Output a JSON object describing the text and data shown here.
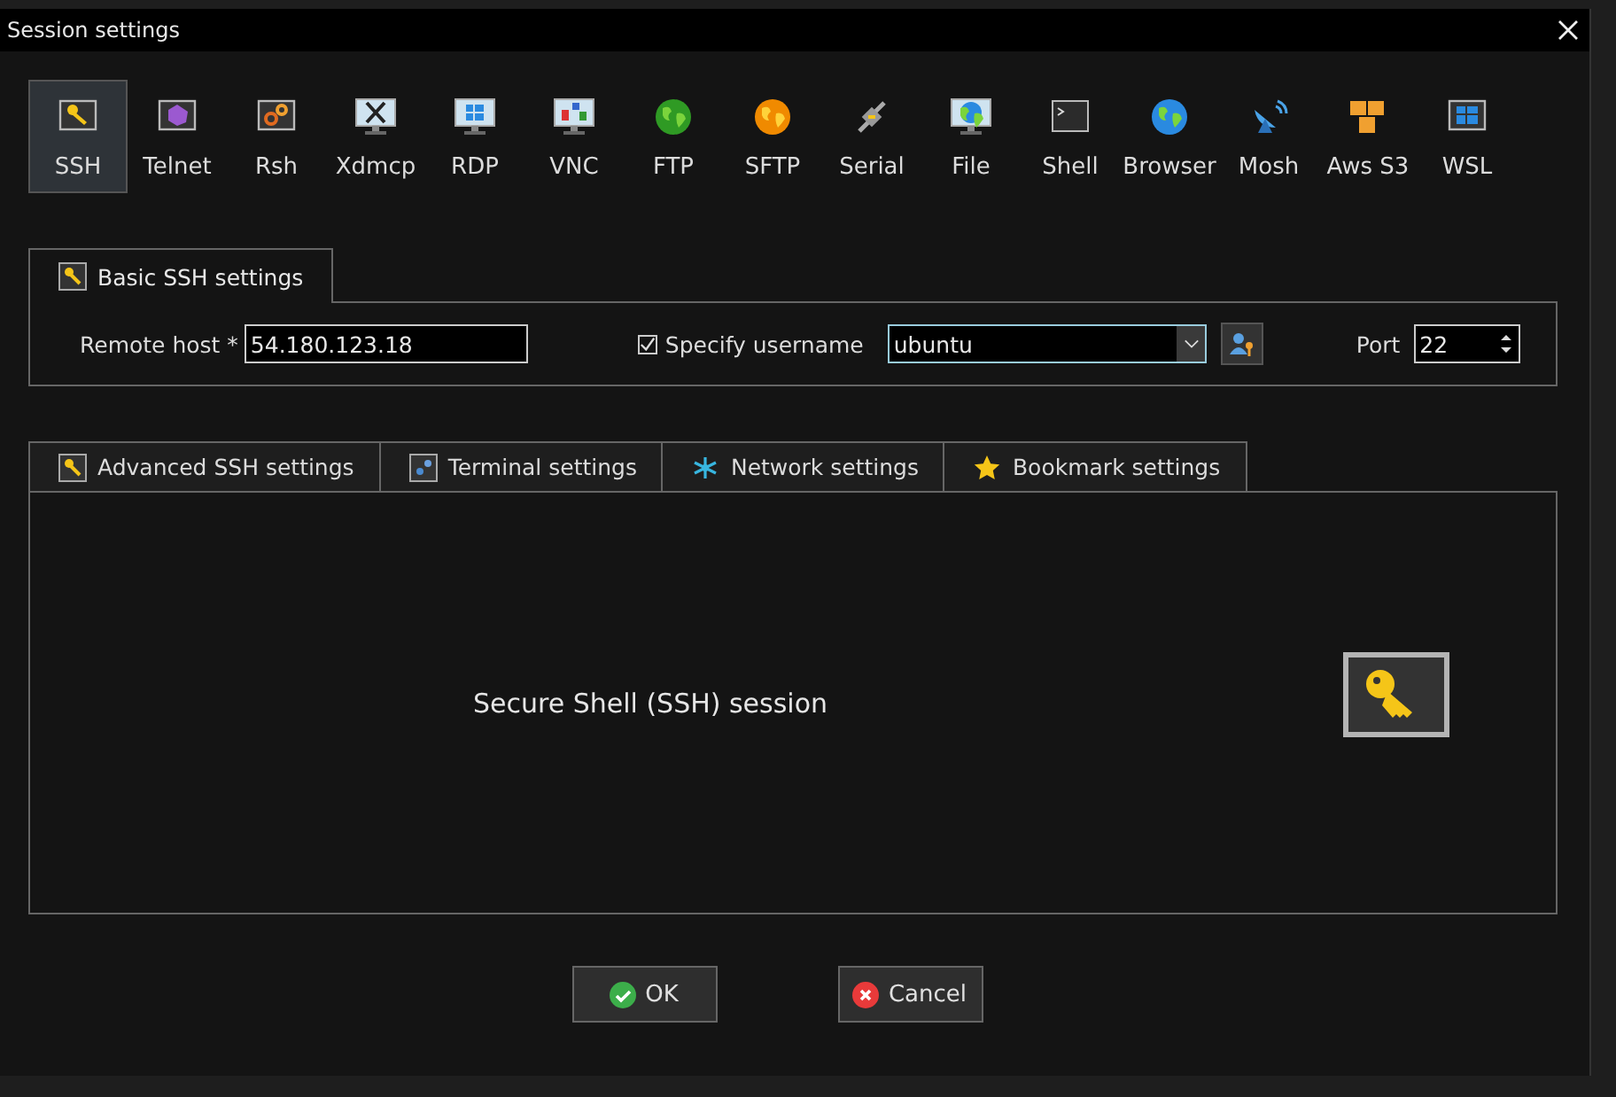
{
  "window": {
    "title": "Session settings"
  },
  "protocols": [
    {
      "label": "SSH",
      "kind": "key",
      "selected": true
    },
    {
      "label": "Telnet",
      "kind": "gem",
      "selected": false
    },
    {
      "label": "Rsh",
      "kind": "gears",
      "selected": false
    },
    {
      "label": "Xdmcp",
      "kind": "xmonitor",
      "selected": false
    },
    {
      "label": "RDP",
      "kind": "winmonitor",
      "selected": false
    },
    {
      "label": "VNC",
      "kind": "vncmonitor",
      "selected": false
    },
    {
      "label": "FTP",
      "kind": "greenglobe",
      "selected": false
    },
    {
      "label": "SFTP",
      "kind": "orangeglobe",
      "selected": false
    },
    {
      "label": "Serial",
      "kind": "plug",
      "selected": false
    },
    {
      "label": "File",
      "kind": "globemonitor",
      "selected": false
    },
    {
      "label": "Shell",
      "kind": "terminal",
      "selected": false
    },
    {
      "label": "Browser",
      "kind": "blueglobe",
      "selected": false
    },
    {
      "label": "Mosh",
      "kind": "dish",
      "selected": false
    },
    {
      "label": "Aws S3",
      "kind": "boxes",
      "selected": false
    },
    {
      "label": "WSL",
      "kind": "windows",
      "selected": false
    }
  ],
  "basic_tab": {
    "label": "Basic SSH settings",
    "selected": true
  },
  "basic": {
    "remote_host_label": "Remote host *",
    "remote_host": "54.180.123.18",
    "specify_username": {
      "label": "Specify username",
      "checked": true
    },
    "username": "ubuntu",
    "port_label": "Port",
    "port": "22"
  },
  "tabs": [
    {
      "label": "Advanced SSH settings",
      "kind": "key",
      "selected": false
    },
    {
      "label": "Terminal settings",
      "kind": "terminal",
      "selected": false
    },
    {
      "label": "Network settings",
      "kind": "network",
      "selected": false
    },
    {
      "label": "Bookmark settings",
      "kind": "star",
      "selected": false
    }
  ],
  "panel": {
    "description": "Secure Shell (SSH) session"
  },
  "buttons": [
    {
      "label": "OK",
      "kind": "ok"
    },
    {
      "label": "Cancel",
      "kind": "cancel"
    }
  ]
}
